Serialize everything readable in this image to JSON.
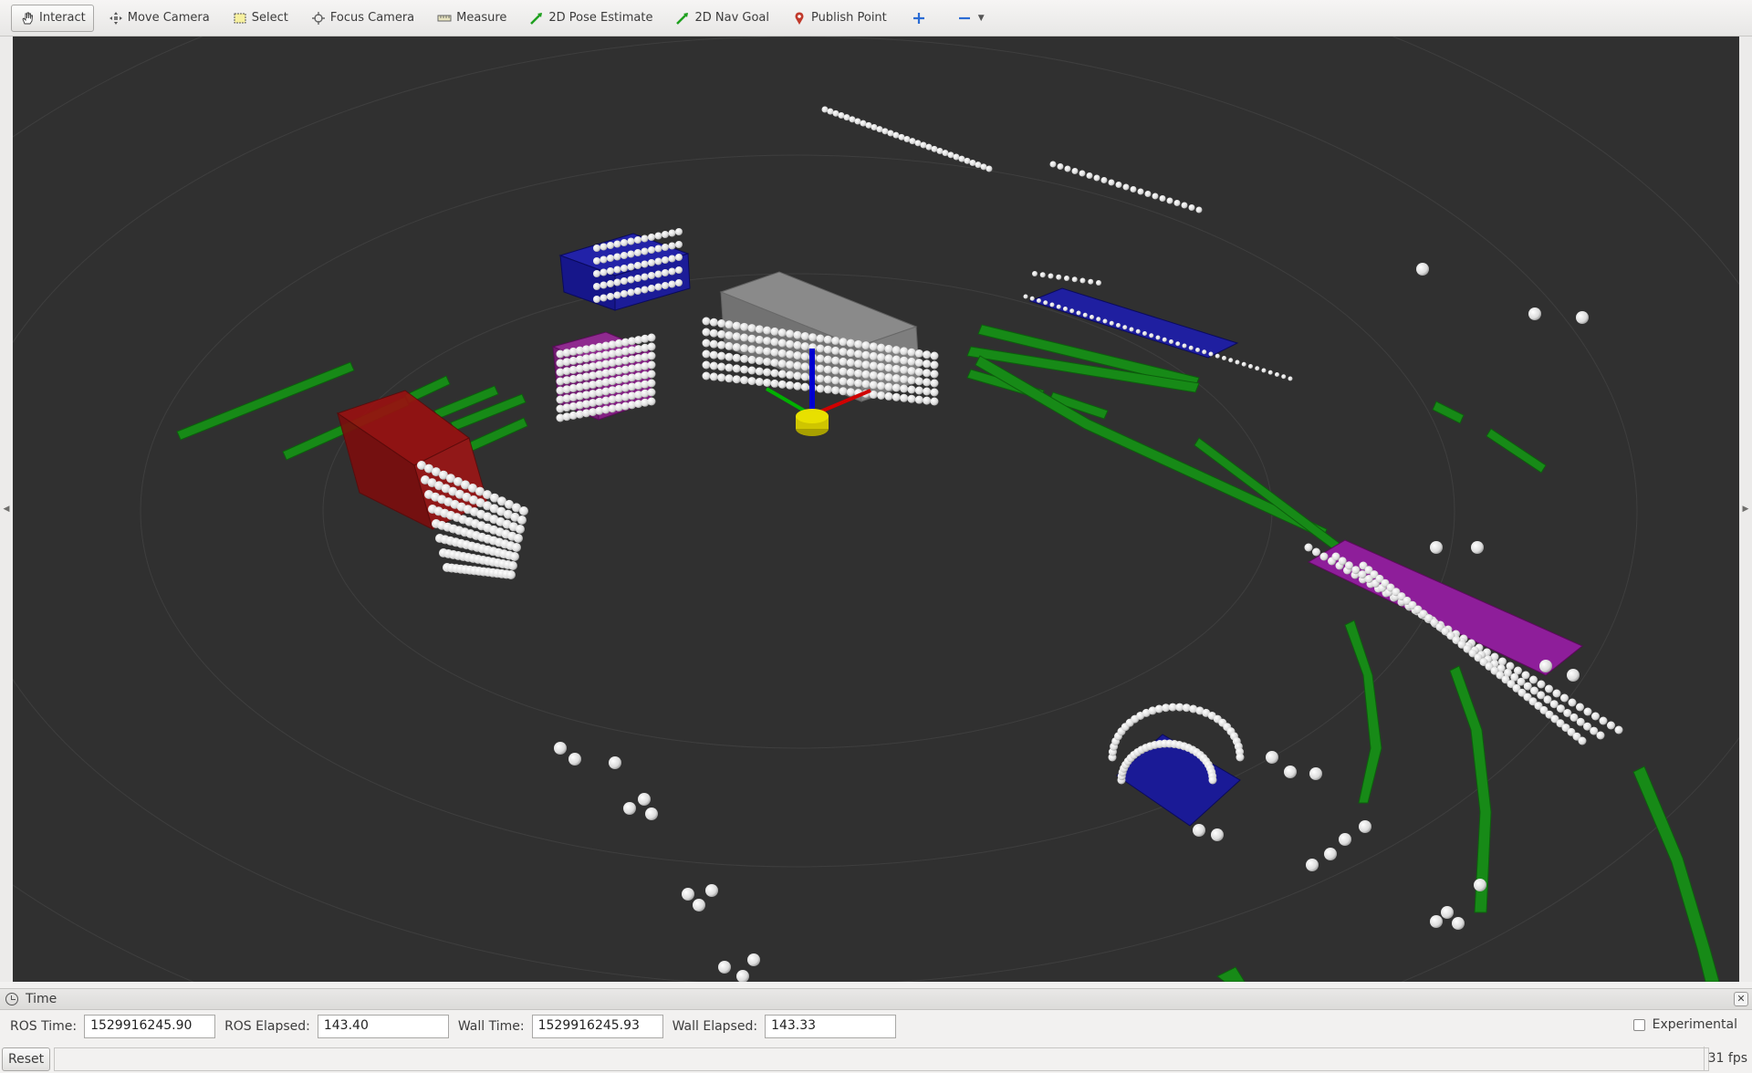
{
  "toolbar": {
    "tools": [
      {
        "label": "Interact",
        "icon": "hand-icon"
      },
      {
        "label": "Move Camera",
        "icon": "move-camera-icon"
      },
      {
        "label": "Select",
        "icon": "select-box-icon"
      },
      {
        "label": "Focus Camera",
        "icon": "focus-crosshair-icon"
      },
      {
        "label": "Measure",
        "icon": "ruler-icon"
      },
      {
        "label": "2D Pose Estimate",
        "icon": "green-arrow-icon"
      },
      {
        "label": "2D Nav Goal",
        "icon": "green-arrow-icon"
      },
      {
        "label": "Publish Point",
        "icon": "map-pin-icon"
      }
    ],
    "active_tool": "Interact"
  },
  "colors": {
    "viewport_bg": "#303030",
    "lane_green": "#1a8f1a",
    "box_blue": "#1a1a8c",
    "box_purple": "#8c1a8c",
    "box_red": "#8c1010",
    "box_grey": "#8a8a8a",
    "points_white": "#f0f0f0",
    "axis_red": "#d00000",
    "axis_green": "#00b000",
    "axis_blue": "#0000d0",
    "origin_yellow": "#d8d000"
  },
  "time_panel": {
    "title": "Time",
    "ros_time_label": "ROS Time:",
    "ros_time_value": "1529916245.90",
    "ros_elapsed_label": "ROS Elapsed:",
    "ros_elapsed_value": "143.40",
    "wall_time_label": "Wall Time:",
    "wall_time_value": "1529916245.93",
    "wall_elapsed_label": "Wall Elapsed:",
    "wall_elapsed_value": "143.33",
    "experimental_label": "Experimental",
    "experimental_checked": false
  },
  "status": {
    "reset_label": "Reset",
    "fps": "31 fps"
  }
}
